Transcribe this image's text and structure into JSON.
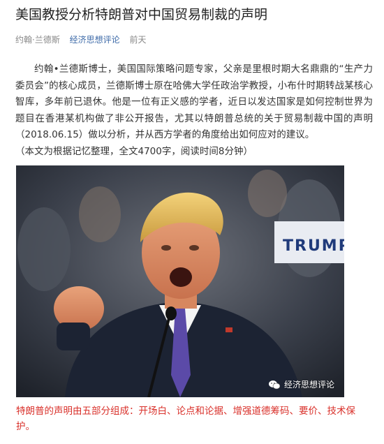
{
  "article": {
    "title": "美国教授分析特朗普对中国贸易制裁的声明",
    "author": "约翰·兰德斯",
    "source": "经济思想评论",
    "time": "前天"
  },
  "body": {
    "paragraph1": "约翰•兰德斯博士，美国国际策略问题专家，父亲是里根时期大名鼎鼎的“生产力委员会”的核心成员，兰德斯博士原在哈佛大学任政治学教授，小布什时期转战某核心智库，多年前已退休。他是一位有正义感的学者，近日以发达国家是如何控制世界为题目在香港某机构做了非公开报告，尤其以特朗普总统的关于贸易制裁中国的声明（2018.06.15）做以分析，并从西方学者的角度给出如何应对的建议。",
    "paragraph2": "（本文为根据记忆整理，全文4700字，阅读时间8分钟）"
  },
  "image": {
    "sign_text": "TRUMP",
    "watermark": "经济思想评论"
  },
  "caption": "特朗普的声明由五部分组成：开场白、论点和论据、增强道德筹码、要价、技术保护。",
  "colors": {
    "source_link": "#3d6aa8",
    "caption": "#d9302a",
    "title": "#222222"
  }
}
